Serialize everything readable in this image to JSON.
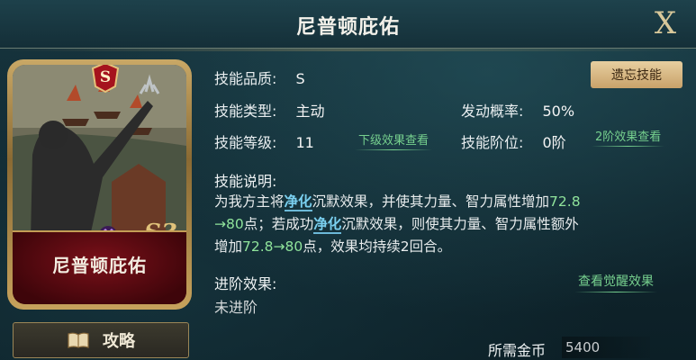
{
  "header": {
    "title": "尼普顿庇佑",
    "close_label": "X"
  },
  "card": {
    "rarity": "S",
    "name": "尼普顿庇佑"
  },
  "guide_button": {
    "label": "攻略"
  },
  "skill": {
    "quality_label": "技能品质:",
    "quality_value": "S",
    "type_label": "技能类型:",
    "type_value": "主动",
    "level_label": "技能等级:",
    "level_value": "11",
    "lower_effect_link": "下级效果查看",
    "proc_label": "发动概率:",
    "proc_value": "50%",
    "stage_label": "技能阶位:",
    "stage_value": "0阶",
    "stage2_link": "2阶效果查看",
    "forget_button": "遗忘技能"
  },
  "description": {
    "label": "技能说明:",
    "t1": "为我方主将",
    "kw1": "净化",
    "t2": "沉默效果，并使其力量、智力属性增加",
    "n1": "72.8",
    "n2": "→80",
    "t3": "点；若成功",
    "kw2": "净化",
    "t4": "沉默效果，则使其力量、智力属性额外",
    "t5": "增加",
    "n3": "72.8",
    "n4": "→80",
    "t6": "点，效果均持续2回合。"
  },
  "advance": {
    "label": "进阶效果:",
    "value": "未进阶",
    "awaken_link": "查看觉醒效果"
  },
  "cost": {
    "label": "所需金币",
    "value": "5400"
  }
}
